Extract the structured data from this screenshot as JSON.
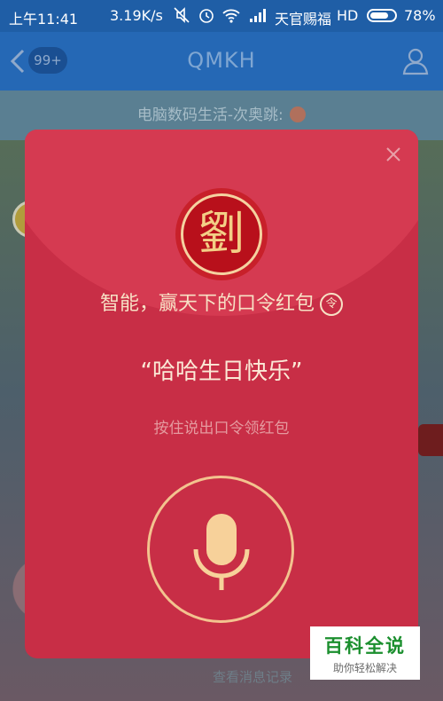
{
  "status_bar": {
    "time": "上午11:41",
    "speed": "3.19K/s",
    "carrier": "天官赐福",
    "network": "HD",
    "battery": "78%",
    "battery_level": 0.78
  },
  "nav": {
    "unread_count": "99+",
    "title": "QMKH"
  },
  "group": {
    "banner": "电脑数码生活-次奥跳:",
    "bottom_hint": "查看消息记录"
  },
  "red_packet": {
    "seal_char": "劉",
    "title": "智能，赢天下的口令红包",
    "badge": "令",
    "password": "“哈哈生日快乐”",
    "hint": "按住说出口令领红包"
  },
  "watermark": {
    "main": "百科全说",
    "sub": "助你轻松解决"
  },
  "colors": {
    "packet": "#c82e46",
    "packet_top": "#d53a51",
    "accent_gold": "#f3c38f",
    "nav_blue": "#2568b5"
  }
}
